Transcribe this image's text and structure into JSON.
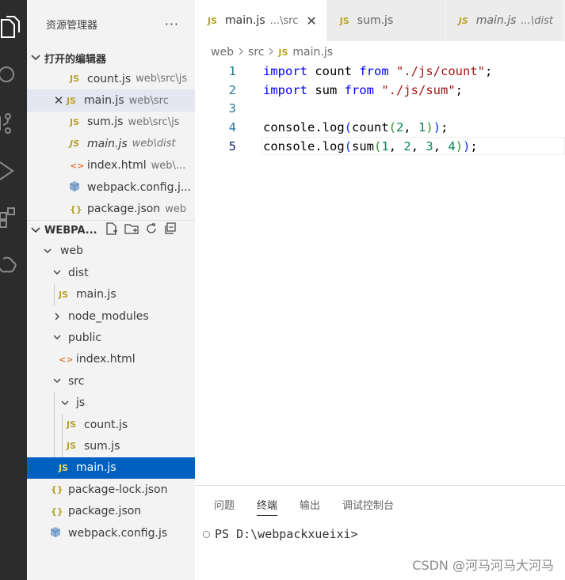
{
  "sidebar": {
    "header_title": "资源管理器",
    "more_label": "···",
    "open_editors": {
      "title": "打开的编辑器",
      "items": [
        {
          "name": "count.js",
          "desc": "web\\src\\js",
          "icon": "JS"
        },
        {
          "name": "main.js",
          "desc": "web\\src",
          "icon": "JS"
        },
        {
          "name": "sum.js",
          "desc": "web\\src\\js",
          "icon": "JS"
        },
        {
          "name": "main.js",
          "desc": "web\\dist",
          "icon": "JS"
        },
        {
          "name": "index.html",
          "desc": "web\\...",
          "icon": "<>"
        },
        {
          "name": "webpack.config.j...",
          "desc": "",
          "icon": "cube"
        },
        {
          "name": "package.json",
          "desc": "web",
          "icon": "{}"
        }
      ]
    },
    "workspace": {
      "title": "WEBPA...",
      "tree": [
        {
          "label": "web"
        },
        {
          "label": "dist"
        },
        {
          "label": "main.js",
          "icon": "JS"
        },
        {
          "label": "node_modules"
        },
        {
          "label": "public"
        },
        {
          "label": "index.html",
          "icon": "<>"
        },
        {
          "label": "src"
        },
        {
          "label": "js"
        },
        {
          "label": "count.js",
          "icon": "JS"
        },
        {
          "label": "sum.js",
          "icon": "JS"
        },
        {
          "label": "main.js",
          "icon": "JS"
        },
        {
          "label": "package-lock.json",
          "icon": "{}"
        },
        {
          "label": "package.json",
          "icon": "{}"
        },
        {
          "label": "webpack.config.js",
          "icon": "cube"
        }
      ]
    }
  },
  "editor": {
    "tabs": [
      {
        "icon": "JS",
        "name": "main.js",
        "desc": "...\\src",
        "close": "✕"
      },
      {
        "icon": "JS",
        "name": "sum.js",
        "desc": ""
      },
      {
        "icon": "JS",
        "name": "main.js",
        "desc": "...\\dist"
      }
    ],
    "breadcrumbs": [
      "web",
      "src",
      "main.js"
    ],
    "breadcrumb_icon": "JS",
    "lines": [
      {
        "n": "1"
      },
      {
        "n": "2"
      },
      {
        "n": "3"
      },
      {
        "n": "4"
      },
      {
        "n": "5"
      }
    ],
    "code": {
      "l1": {
        "kw1": "import",
        "id": " count ",
        "kw2": "from",
        "sp": " ",
        "str": "\"./js/count\"",
        "end": ";"
      },
      "l2": {
        "kw1": "import",
        "id": " sum ",
        "kw2": "from",
        "sp": " ",
        "str": "\"./js/sum\"",
        "end": ";"
      },
      "l4": {
        "a": "console.log",
        "p1": "(",
        "b": "count",
        "p2": "(",
        "n1": "2",
        "c": ", ",
        "n2": "1",
        "p3": ")",
        "p4": ")",
        "end": ";"
      },
      "l5": {
        "a": "console.log",
        "p1": "(",
        "b": "sum",
        "p2": "(",
        "n1": "1",
        "c1": ", ",
        "n2": "2",
        "c2": ", ",
        "n3": "3",
        "c3": ", ",
        "n4": "4",
        "p3": ")",
        "p4": ")",
        "end": ";"
      }
    }
  },
  "panel": {
    "tabs": [
      "问题",
      "终端",
      "输出",
      "调试控制台"
    ],
    "terminal_prompt": "PS D:\\webpackxueixi>"
  },
  "watermark": "CSDN @河马河马大河马"
}
